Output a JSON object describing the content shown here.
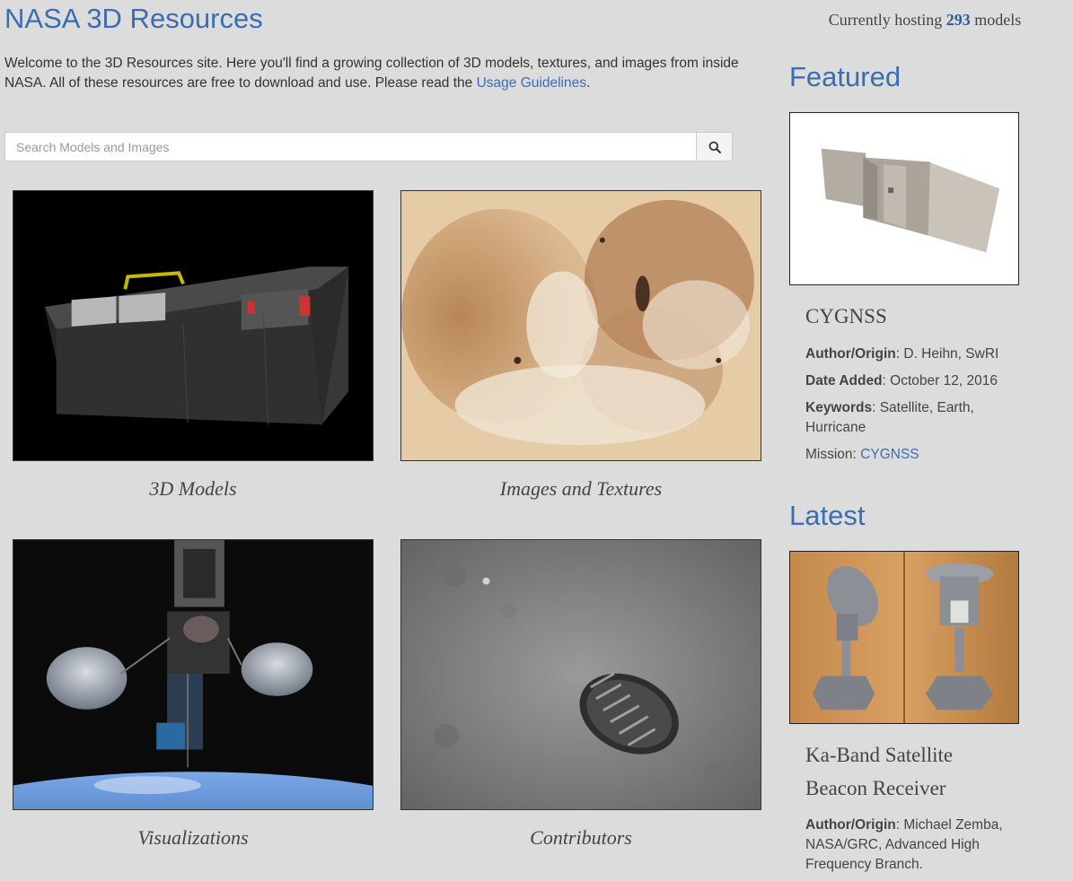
{
  "header": {
    "title": "NASA 3D Resources",
    "hosting_prefix": "Currently hosting",
    "hosting_count": "293",
    "hosting_suffix": "models"
  },
  "intro": {
    "text": "Welcome to the 3D Resources site. Here you'll find a growing collection of 3D models, textures, and images from inside NASA. All of these resources are free to download and use. Please read the",
    "link": "Usage Guidelines",
    "end": "."
  },
  "search": {
    "placeholder": "Search Models and Images",
    "icon": "search-icon"
  },
  "tiles": [
    {
      "caption": "3D Models"
    },
    {
      "caption": "Images and Textures"
    },
    {
      "caption": "Visualizations"
    },
    {
      "caption": "Contributors"
    }
  ],
  "featured": {
    "heading": "Featured",
    "name": "CYGNSS",
    "author_label": "Author/Origin",
    "author": "D. Heihn, SwRI",
    "date_label": "Date Added",
    "date": "October 12, 2016",
    "keywords_label": "Keywords",
    "keywords": "Satellite, Earth, Hurricane",
    "mission_label": "Mission:",
    "mission": "CYGNSS"
  },
  "latest": {
    "heading": "Latest",
    "name_line1": "Ka-Band Satellite",
    "name_line2": "Beacon Receiver",
    "author_label": "Author/Origin",
    "author": "Michael Zemba, NASA/GRC, Advanced High Frequency Branch."
  },
  "colors": {
    "background": "#dcdcdc",
    "accent": "#3a6db5"
  }
}
